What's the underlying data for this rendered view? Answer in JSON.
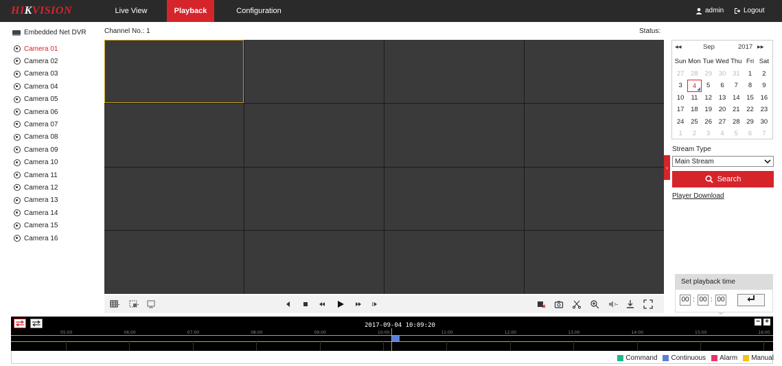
{
  "app": {
    "logo_red": "HI",
    "logo_white": "K",
    "logo_rest": "VISION"
  },
  "nav": {
    "items": [
      {
        "label": "Live View"
      },
      {
        "label": "Playback"
      },
      {
        "label": "Configuration"
      }
    ],
    "active": "Playback"
  },
  "user": {
    "name": "admin",
    "logout_label": "Logout"
  },
  "sidebar": {
    "root_label": "Embedded Net DVR",
    "cameras": [
      "Camera 01",
      "Camera 02",
      "Camera 03",
      "Camera 04",
      "Camera 05",
      "Camera 06",
      "Camera 07",
      "Camera 08",
      "Camera 09",
      "Camera 10",
      "Camera 11",
      "Camera 12",
      "Camera 13",
      "Camera 14",
      "Camera 15",
      "Camera 16"
    ],
    "selected": "Camera 01"
  },
  "main": {
    "channel_label": "Channel No.: 1",
    "status_label": "Status:"
  },
  "calendar": {
    "month": "Sep",
    "year": "2017",
    "weekdays": [
      "Sun",
      "Mon",
      "Tue",
      "Wed",
      "Thu",
      "Fri",
      "Sat"
    ],
    "days": [
      [
        "27",
        "28",
        "29",
        "30",
        "31",
        "1",
        "2"
      ],
      [
        "3",
        "4",
        "5",
        "6",
        "7",
        "8",
        "9"
      ],
      [
        "10",
        "11",
        "12",
        "13",
        "14",
        "15",
        "16"
      ],
      [
        "17",
        "18",
        "19",
        "20",
        "21",
        "22",
        "23"
      ],
      [
        "24",
        "25",
        "26",
        "27",
        "28",
        "29",
        "30"
      ],
      [
        "1",
        "2",
        "3",
        "4",
        "5",
        "6",
        "7"
      ]
    ],
    "today": "4"
  },
  "stream": {
    "label": "Stream Type",
    "value": "Main Stream"
  },
  "search": {
    "label": "Search"
  },
  "player_download": "Player Download",
  "playback_time": {
    "title": "Set playback time",
    "hh": "00",
    "mm": "00",
    "ss": "00"
  },
  "timeline": {
    "current": "2017-09-04 10:09:20",
    "ticks": [
      "05:00",
      "06:00",
      "07:00",
      "08:00",
      "09:00",
      "10:00",
      "11:00",
      "12:00",
      "13:00",
      "14:00",
      "15:00",
      "16:00"
    ]
  },
  "legend": [
    {
      "label": "Command",
      "color": "#1fb88b"
    },
    {
      "label": "Continuous",
      "color": "#5a7fd8"
    },
    {
      "label": "Alarm",
      "color": "#e8356d"
    },
    {
      "label": "Manual",
      "color": "#f2c21a"
    }
  ],
  "colors": {
    "accent": "#d6242b",
    "header_bg": "#2a2a2a",
    "selection": "#c8a218"
  }
}
